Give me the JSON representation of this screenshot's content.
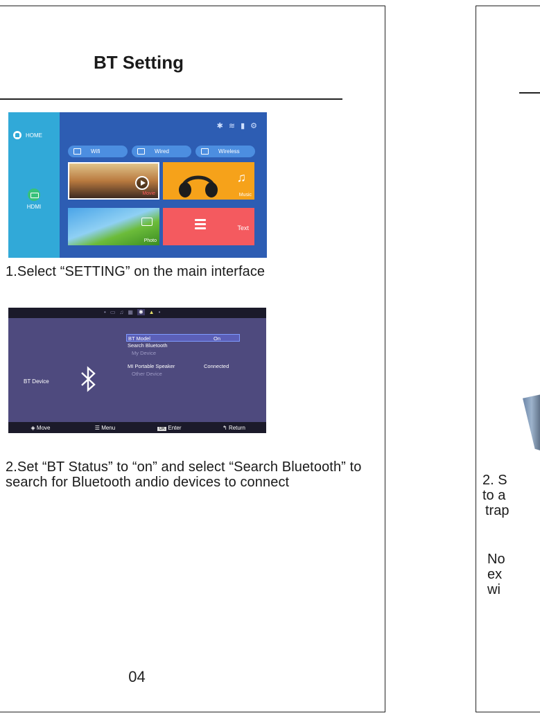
{
  "page_title": "BT Setting",
  "home_screen": {
    "home_label": "HOME",
    "hdmi_label": "HDMI",
    "pills": [
      "Wifi",
      "Wired",
      "Wireless"
    ],
    "tiles": {
      "movie": "Movie",
      "music": "Music",
      "photo": "Photo",
      "text": "Text"
    }
  },
  "step1": "1.Select “SETTING” on the main interface",
  "bt_screen": {
    "device_label": "BT Device",
    "menu": {
      "bt_model": "BT Model",
      "bt_model_value": "On",
      "search": "Search Bluetooth",
      "my_device": "My Device",
      "speaker": "MI Portable Speaker",
      "speaker_status": "Connected",
      "other_device": "Other Device"
    },
    "bottom_bar": [
      "Move",
      "Menu",
      "Enter",
      "Return"
    ],
    "bottom_keys": {
      "ok": "OK"
    }
  },
  "step2": "2.Set “BT Status” to “on”  and select “Search Bluetooth” to search for Bluetooth andio devices to connect",
  "page_number": "04",
  "right_page_fragments": [
    "2. S",
    "to a",
    "trap",
    "No",
    "ex",
    "wi"
  ],
  "colors": {
    "home_bg": "#2d5db3",
    "home_sidebar": "#31a9d8",
    "bt_bg": "#4e4a7e"
  }
}
